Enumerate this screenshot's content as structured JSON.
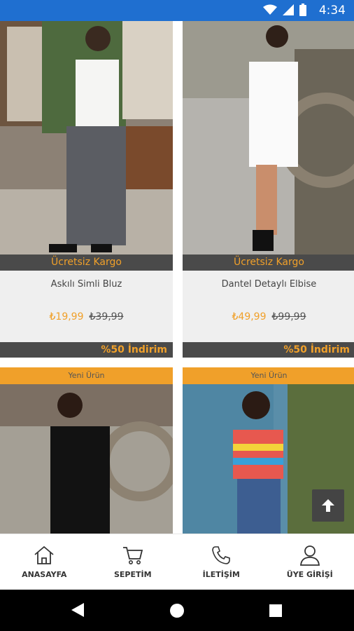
{
  "status_bar": {
    "time": "4:34"
  },
  "products": [
    {
      "badge": "Ücretsiz Kargo",
      "name": "Askılı Simli Bluz",
      "price": "₺19,99",
      "old_price": "₺39,99",
      "discount": "%50 İndirim"
    },
    {
      "badge": "Ücretsiz Kargo",
      "name": "Dantel Detaylı Elbise",
      "price": "₺49,99",
      "old_price": "₺99,99",
      "discount": "%50 İndirim"
    },
    {
      "badge": "Yeni Ürün"
    },
    {
      "badge": "Yeni Ürün"
    }
  ],
  "scroll_top_icon": "arrow-up-icon",
  "bottom_nav": [
    {
      "label": "ANASAYFA",
      "icon": "home-icon"
    },
    {
      "label": "SEPETİM",
      "icon": "cart-icon"
    },
    {
      "label": "İLETİŞİM",
      "icon": "phone-icon"
    },
    {
      "label": "ÜYE GİRİŞİ",
      "icon": "user-icon"
    }
  ],
  "colors": {
    "accent": "#f0a02a",
    "dark_bar": "#4a4a4a",
    "status_bar": "#1f6fd0"
  }
}
